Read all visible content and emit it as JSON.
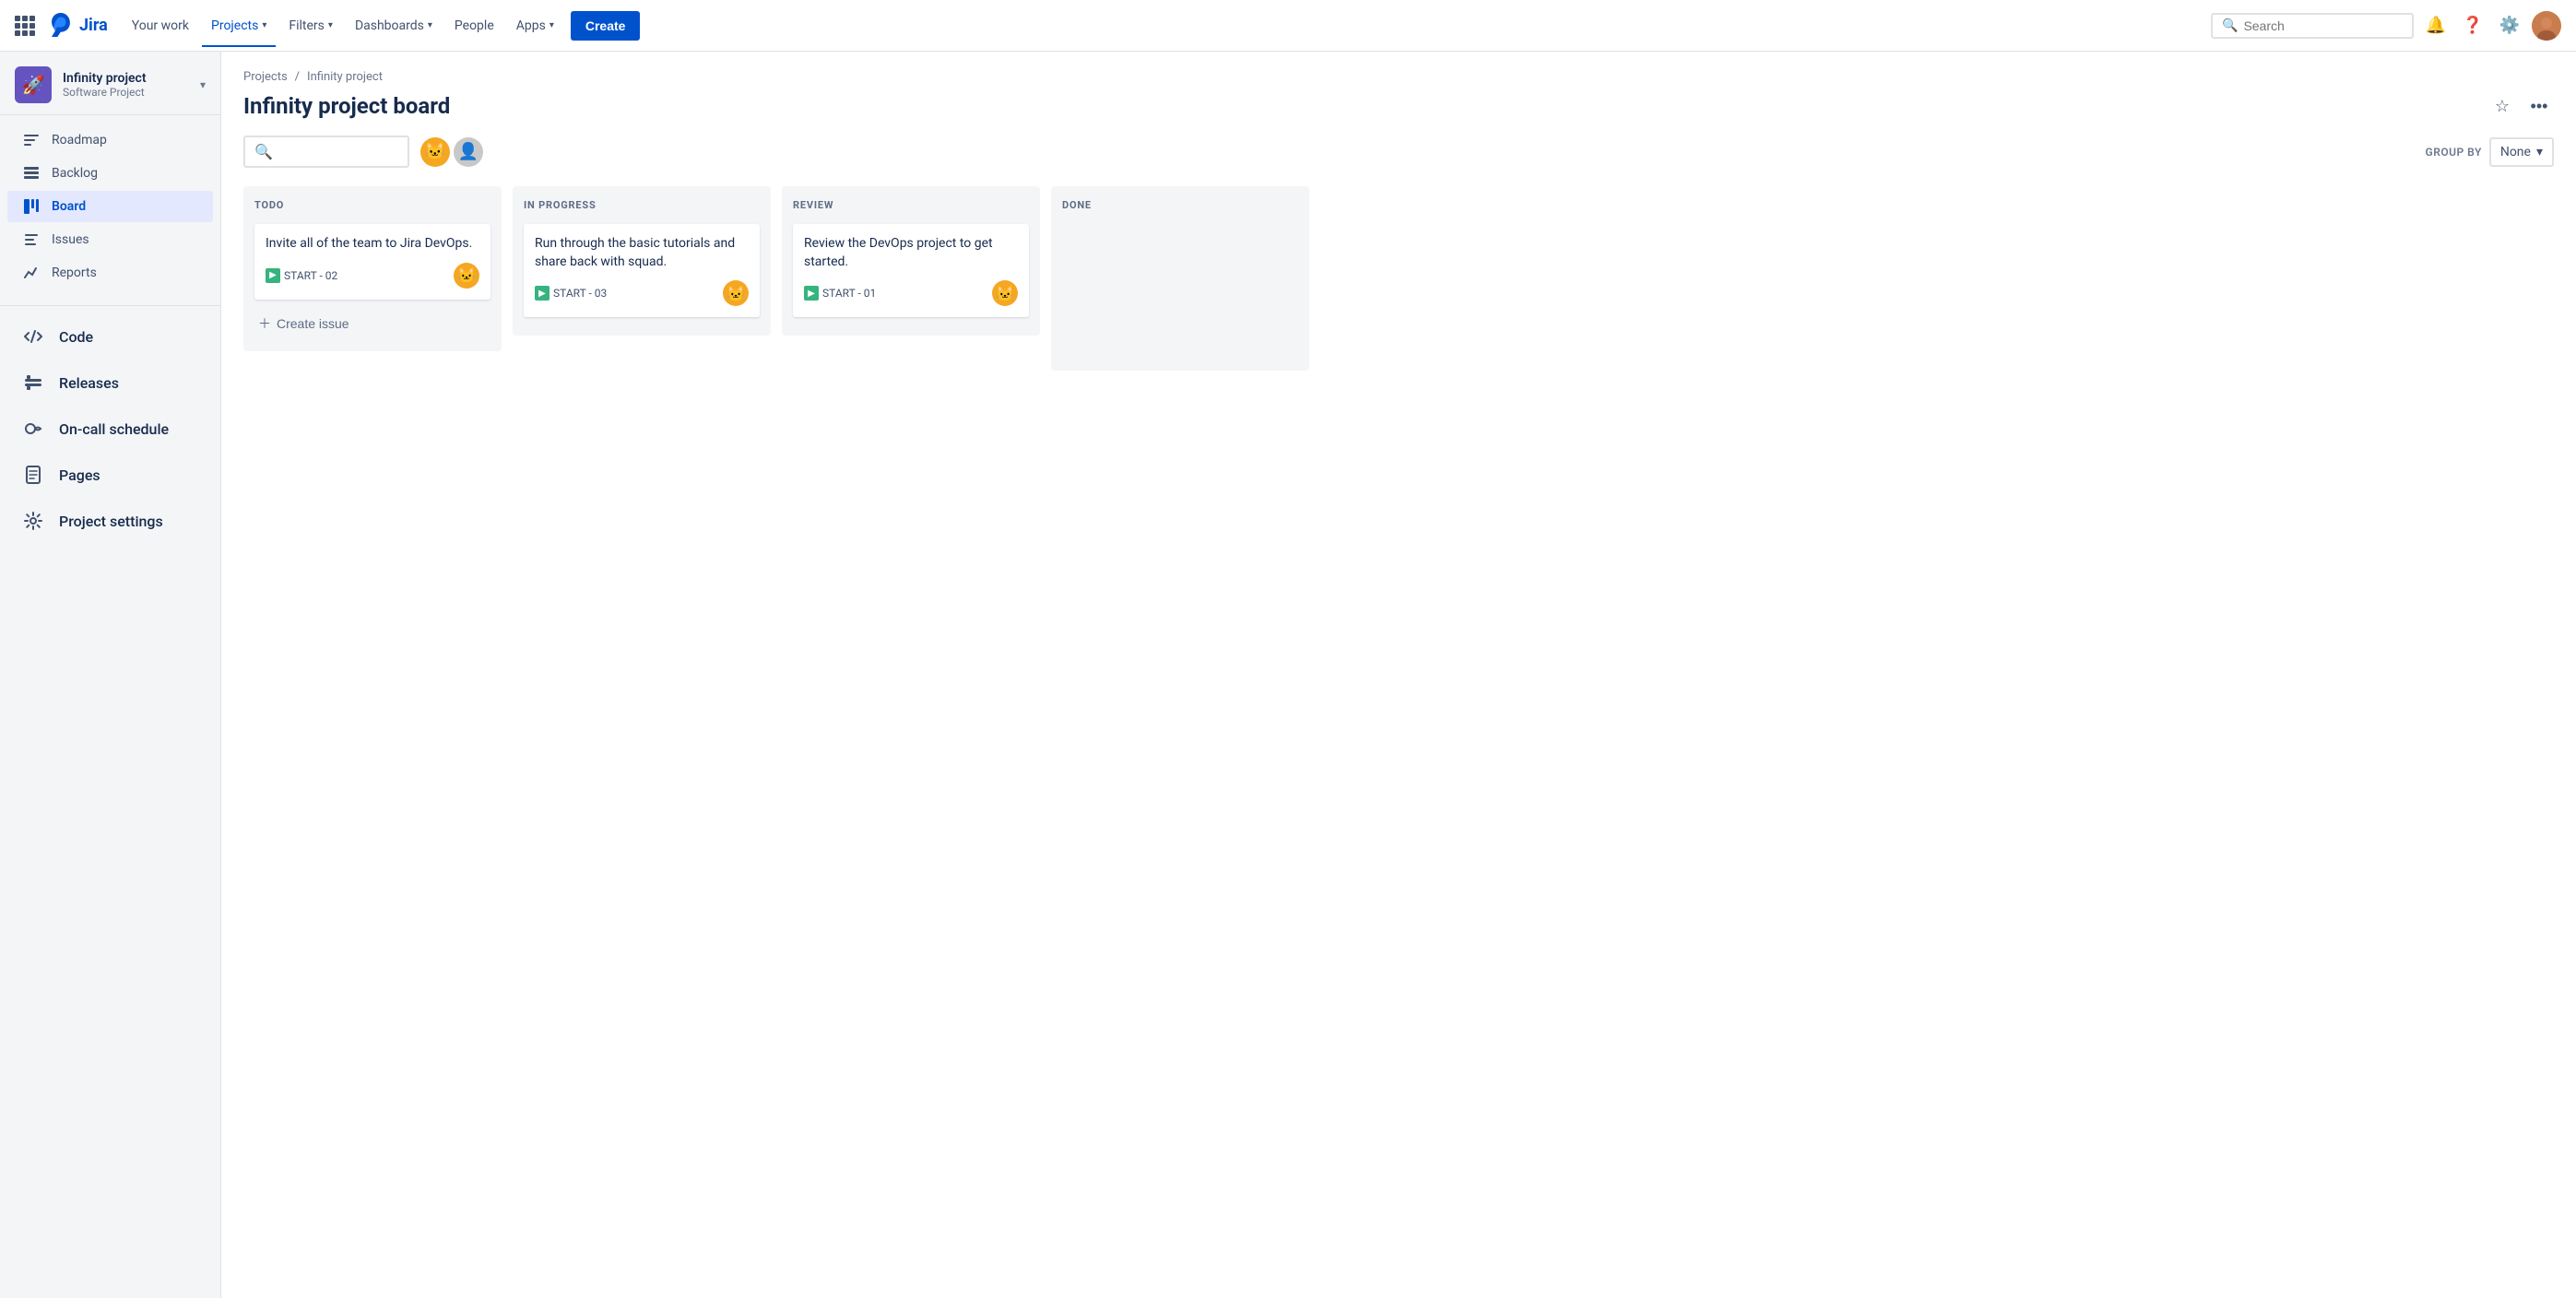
{
  "topnav": {
    "logo_text": "Jira",
    "nav_items": [
      {
        "label": "Your work",
        "active": false
      },
      {
        "label": "Projects",
        "active": true
      },
      {
        "label": "Filters",
        "active": false
      },
      {
        "label": "Dashboards",
        "active": false
      },
      {
        "label": "People",
        "active": false
      },
      {
        "label": "Apps",
        "active": false
      }
    ],
    "create_label": "Create",
    "search_placeholder": "Search"
  },
  "sidebar": {
    "project_name": "Infinity project",
    "project_type": "Software Project",
    "nav_items": [
      {
        "label": "Roadmap",
        "icon": "roadmap"
      },
      {
        "label": "Backlog",
        "icon": "backlog"
      },
      {
        "label": "Board",
        "icon": "board",
        "active": true
      },
      {
        "label": "Issues",
        "icon": "issues"
      },
      {
        "label": "Reports",
        "icon": "reports"
      }
    ],
    "large_items": [
      {
        "label": "Code",
        "icon": "code"
      },
      {
        "label": "Releases",
        "icon": "releases"
      },
      {
        "label": "On-call schedule",
        "icon": "oncall"
      },
      {
        "label": "Pages",
        "icon": "pages"
      },
      {
        "label": "Project settings",
        "icon": "settings"
      }
    ]
  },
  "board": {
    "breadcrumb_project": "Projects",
    "breadcrumb_sep": "/",
    "breadcrumb_current": "Infinity project",
    "title": "Infinity project board",
    "group_by_label": "GROUP BY",
    "group_by_value": "None",
    "columns": [
      {
        "id": "todo",
        "label": "TODO",
        "cards": [
          {
            "title": "Invite all of the team to Jira DevOps.",
            "tag": "START - 02",
            "has_assignee": true
          }
        ],
        "create_issue_label": "Create issue"
      },
      {
        "id": "inprogress",
        "label": "IN PROGRESS",
        "cards": [
          {
            "title": "Run through the basic tutorials and share back with squad.",
            "tag": "START - 03",
            "has_assignee": true
          }
        ],
        "create_issue_label": null
      },
      {
        "id": "review",
        "label": "REVIEW",
        "cards": [
          {
            "title": "Review the DevOps project to get started.",
            "tag": "START - 01",
            "has_assignee": true
          }
        ],
        "create_issue_label": null
      },
      {
        "id": "done",
        "label": "DONE",
        "cards": [],
        "create_issue_label": null
      }
    ]
  }
}
